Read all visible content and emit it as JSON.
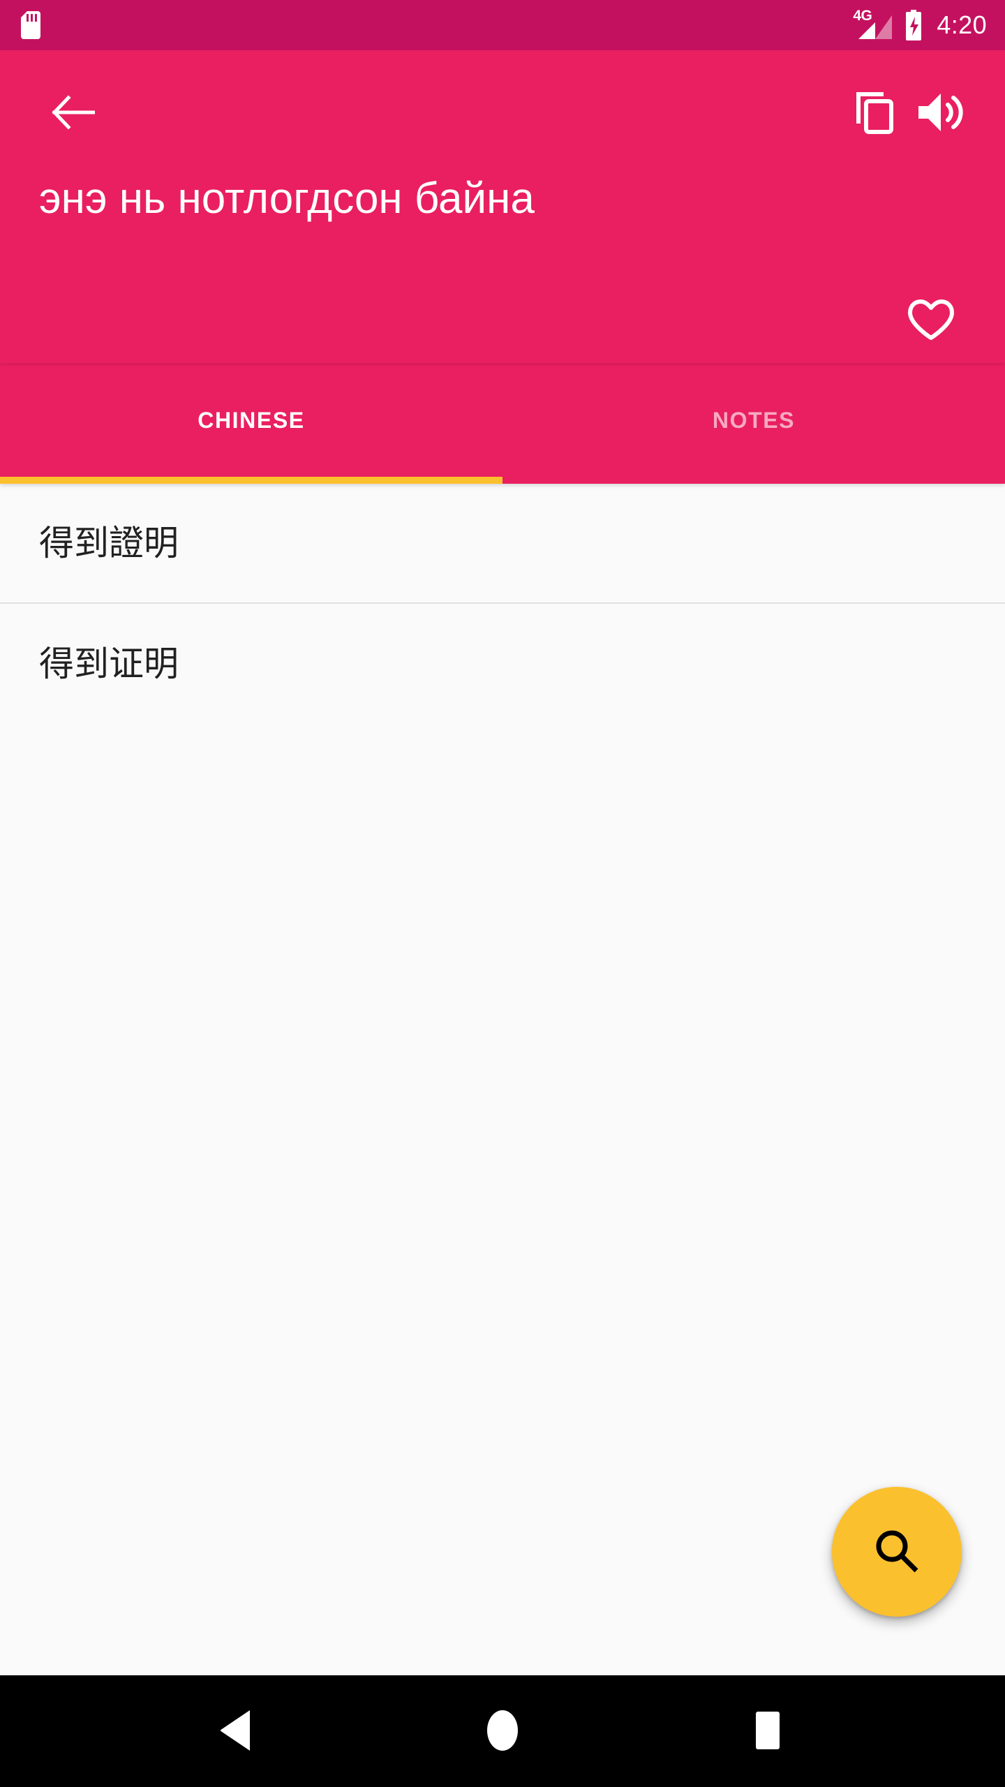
{
  "status_bar": {
    "sd_card_icon": "sd-card-icon",
    "network_type": "4G",
    "signal_icon": "signal-bars-icon",
    "battery_icon": "battery-charging-icon",
    "time": "4:20",
    "background_color": "#c4115f"
  },
  "app_bar": {
    "background_color": "#e91f61",
    "back_icon": "back-arrow-icon",
    "copy_icon": "content-copy-icon",
    "speaker_icon": "volume-up-icon",
    "title": "энэ нь нотлогдсон байна",
    "favorite_icon": "heart-outline-icon",
    "favorite_state": "not-favorited"
  },
  "tabs": {
    "indicator_color": "#fbc02d",
    "active_index": 0,
    "items": [
      {
        "label": "CHINESE",
        "active": true
      },
      {
        "label": "NOTES",
        "active": false
      }
    ]
  },
  "content": {
    "background_color": "#fafafa",
    "entries": [
      {
        "text": "得到證明",
        "script": "traditional"
      },
      {
        "text": "得到证明",
        "script": "simplified"
      }
    ]
  },
  "fab": {
    "icon": "search-icon",
    "background_color": "#fbc02d",
    "icon_color": "#000000",
    "label": "Search"
  },
  "nav_bar": {
    "background_color": "#000000",
    "buttons": [
      {
        "name": "back",
        "icon": "nav-back-triangle-icon"
      },
      {
        "name": "home",
        "icon": "nav-home-circle-icon"
      },
      {
        "name": "recents",
        "icon": "nav-recents-square-icon"
      }
    ]
  }
}
